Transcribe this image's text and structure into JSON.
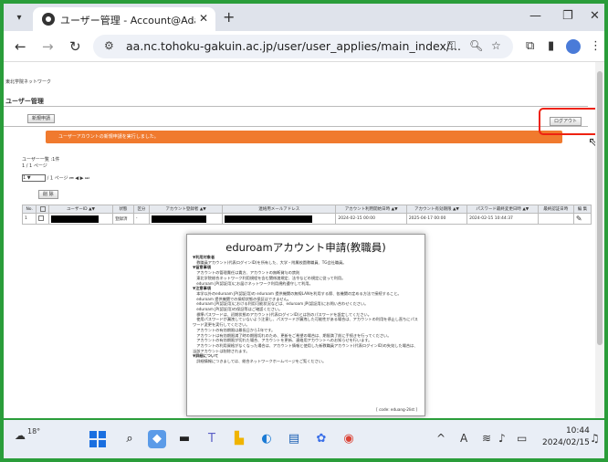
{
  "browser": {
    "tab_title": "ユーザー管理 - Account@Adapte",
    "url": "aa.nc.tohoku-gakuin.ac.jp/user/user_applies/main_index/...",
    "new_tab_symbol": "+",
    "close_symbol": "✕"
  },
  "page": {
    "breadcrumb": "東北学院ネットワーク",
    "heading": "ユーザー管理",
    "button_new": "新規申請",
    "logout": "ログアウト",
    "banner": "ユーザーアカウントの新規申請を実行しました。",
    "list_title": "ユーザー一覧 :1件",
    "list_pages": "1 / 1 ページ",
    "pager_select": "1",
    "pager_text": "/ 1 ページ",
    "delete_button": "削 除",
    "table": {
      "headers": [
        "No.",
        "",
        "ユーザーID ▲▼",
        "状態",
        "区分",
        "アカウント登録者 ▲▼",
        "連絡用メールアドレス",
        "アカウント利用開始日時 ▲▼",
        "アカウント有効期限 ▲▼",
        "パスワード最終変更日時 ▲▼",
        "最終認証日時",
        "編 集"
      ],
      "row": {
        "no": "1",
        "status": "登録済",
        "category": "-",
        "start": "2024-02-15 00:00",
        "expire": "2025-04-17 00:00",
        "pw_changed": "2024-02-15 10:44:37"
      }
    }
  },
  "modal": {
    "title": "eduroamアカウント申請(教職員)",
    "lines": [
      {
        "cls": "sec",
        "text": "▼利用対象者"
      },
      {
        "cls": "",
        "text": "　教職員アカウント(代表ログインID)を所有した、大学・附属校園教職員、TG会社職員。"
      },
      {
        "cls": "sec",
        "text": "▼留意事項"
      },
      {
        "cls": "",
        "text": "　アカウントの管理責任は貴方、アカウントの無断貸与の禁則"
      },
      {
        "cls": "",
        "text": "　東北学院総合ネットワーク利用規程を含む関係諸規定、法令などの規定に従って利用。"
      },
      {
        "cls": "",
        "text": "　eduroam JP(認証用)にお届けネットワーク利用規約遵守して利用。"
      },
      {
        "cls": "sec",
        "text": "▼注意事項"
      },
      {
        "cls": "",
        "text": "　本学以外のeduroam JP(認証用)の eduroam 提供機関の無線LANを利用する際、各機関の定める方法で接続すること。"
      },
      {
        "cls": "",
        "text": "　eduroam 提供機関での接続状態の保証はできません。"
      },
      {
        "cls": "",
        "text": "　eduroam JP(認証用)における利用可能状況などは、eduroam JP(認証用)にお問い合わせください。"
      },
      {
        "cls": "",
        "text": "　eduroam JP(認証用)の保証等はご確認ください。"
      },
      {
        "cls": "",
        "text": "　標準パスワードは、初期状態のアカウント(代表ログインID)とは別のパスワードを設定してください。"
      },
      {
        "cls": "",
        "text": "　使用パスワードが漏洩していないよう注意し、パスワードが漏洩した可能性がある場合は、アカウントの利用を停止し直ちにパスワード変更を実行してください。"
      },
      {
        "cls": "",
        "text": "　アカウントの有効期限は最長日から1年です。"
      },
      {
        "cls": "",
        "text": "　アカウントは有効期限満了時の期限切れのため、更新をご希望の場合は、期限満了前に手続きを行ってください。"
      },
      {
        "cls": "",
        "text": "　アカウントの有効期限が切れた場合、アカウントを更新、連絡用アカウントへのお知らせを行います。"
      },
      {
        "cls": "",
        "text": "　アカウントの利用資格がなくなった場合は、アカウント情報と使用した新教職員アカウント(代表ログインID)の失効した場合は、当該アカウントは削除されます。"
      },
      {
        "cls": "sec",
        "text": "▼詳細について"
      },
      {
        "cls": "",
        "text": "　詳細情報につきましては、総合ネットワークホームページをご覧ください。"
      }
    ],
    "code": "[ code: eduang-2list ]"
  },
  "taskbar": {
    "weather_temp": "18°",
    "time": "10:44",
    "date": "2024/02/15",
    "lang": "A"
  }
}
